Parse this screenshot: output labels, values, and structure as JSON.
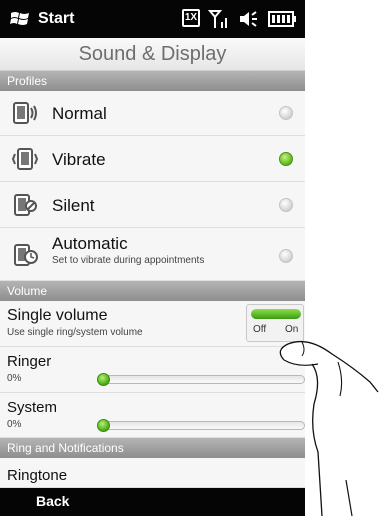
{
  "status_bar": {
    "start_label": "Start",
    "network_label": "1X"
  },
  "header": {
    "title": "Sound & Display"
  },
  "sections": {
    "profiles": "Profiles",
    "volume": "Volume",
    "ring": "Ring and Notifications"
  },
  "profiles": [
    {
      "label": "Normal",
      "subtitle": "",
      "selected": false,
      "icon": "phone-sound-icon"
    },
    {
      "label": "Vibrate",
      "subtitle": "",
      "selected": true,
      "icon": "phone-vibrate-icon"
    },
    {
      "label": "Silent",
      "subtitle": "",
      "selected": false,
      "icon": "phone-silent-icon"
    },
    {
      "label": "Automatic",
      "subtitle": "Set to vibrate during appointments",
      "selected": false,
      "icon": "phone-clock-icon"
    }
  ],
  "volume": {
    "single_volume": {
      "label": "Single volume",
      "subtitle": "Use single ring/system volume",
      "toggle_off": "Off",
      "toggle_on": "On",
      "enabled": true
    },
    "ringer": {
      "label": "Ringer",
      "value": "0%",
      "level": 0
    },
    "system": {
      "label": "System",
      "value": "0%",
      "level": 0
    }
  },
  "ring": {
    "ringtone_label": "Ringtone"
  },
  "bottom_bar": {
    "back_label": "Back"
  },
  "colors": {
    "accent_green": "#55b51a",
    "bar_black": "#050505",
    "section_gray": "#9e9e9e"
  }
}
